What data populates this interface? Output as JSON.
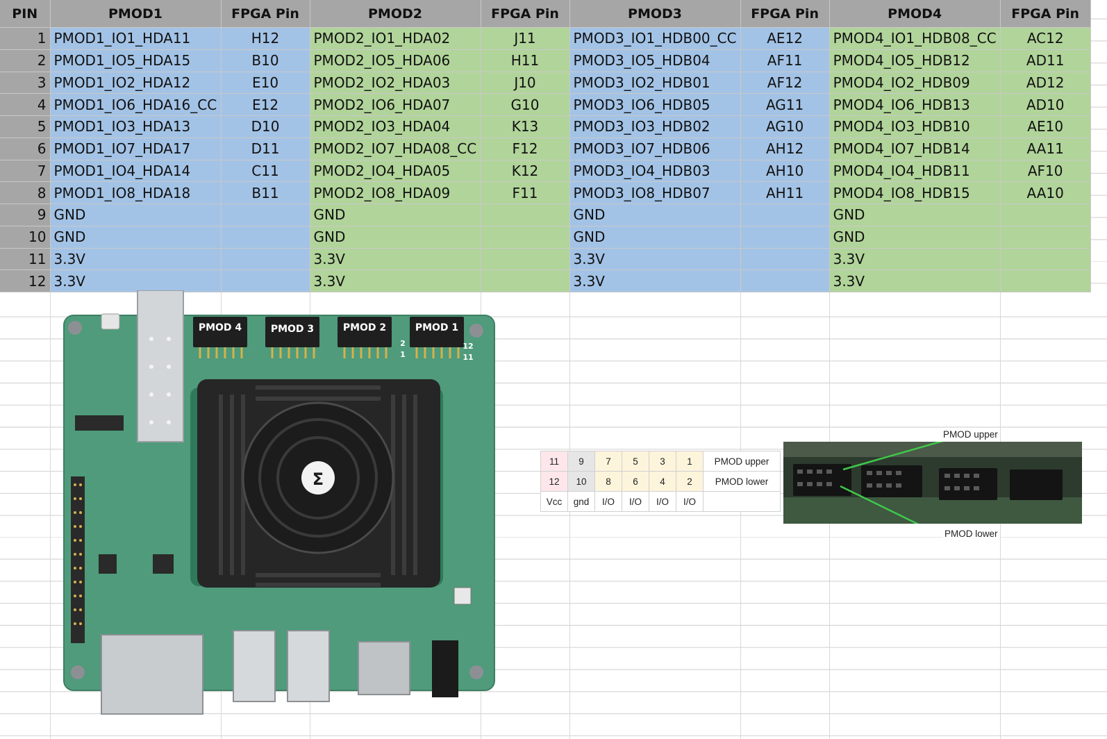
{
  "table": {
    "headers": [
      "PIN",
      "PMOD1",
      "FPGA Pin",
      "PMOD2",
      "FPGA Pin",
      "PMOD3",
      "FPGA Pin",
      "PMOD4",
      "FPGA Pin"
    ],
    "rows": [
      [
        "1",
        "PMOD1_IO1_HDA11",
        "H12",
        "PMOD2_IO1_HDA02",
        "J11",
        "PMOD3_IO1_HDB00_CC",
        "AE12",
        "PMOD4_IO1_HDB08_CC",
        "AC12"
      ],
      [
        "2",
        "PMOD1_IO5_HDA15",
        "B10",
        "PMOD2_IO5_HDA06",
        "H11",
        "PMOD3_IO5_HDB04",
        "AF11",
        "PMOD4_IO5_HDB12",
        "AD11"
      ],
      [
        "3",
        "PMOD1_IO2_HDA12",
        "E10",
        "PMOD2_IO2_HDA03",
        "J10",
        "PMOD3_IO2_HDB01",
        "AF12",
        "PMOD4_IO2_HDB09",
        "AD12"
      ],
      [
        "4",
        "PMOD1_IO6_HDA16_CC",
        "E12",
        "PMOD2_IO6_HDA07",
        "G10",
        "PMOD3_IO6_HDB05",
        "AG11",
        "PMOD4_IO6_HDB13",
        "AD10"
      ],
      [
        "5",
        "PMOD1_IO3_HDA13",
        "D10",
        "PMOD2_IO3_HDA04",
        "K13",
        "PMOD3_IO3_HDB02",
        "AG10",
        "PMOD4_IO3_HDB10",
        "AE10"
      ],
      [
        "6",
        "PMOD1_IO7_HDA17",
        "D11",
        "PMOD2_IO7_HDA08_CC",
        "F12",
        "PMOD3_IO7_HDB06",
        "AH12",
        "PMOD4_IO7_HDB14",
        "AA11"
      ],
      [
        "7",
        "PMOD1_IO4_HDA14",
        "C11",
        "PMOD2_IO4_HDA05",
        "K12",
        "PMOD3_IO4_HDB03",
        "AH10",
        "PMOD4_IO4_HDB11",
        "AF10"
      ],
      [
        "8",
        "PMOD1_IO8_HDA18",
        "B11",
        "PMOD2_IO8_HDA09",
        "F11",
        "PMOD3_IO8_HDB07",
        "AH11",
        "PMOD4_IO8_HDB15",
        "AA10"
      ],
      [
        "9",
        "GND",
        "",
        "GND",
        "",
        "GND",
        "",
        "GND",
        ""
      ],
      [
        "10",
        "GND",
        "",
        "GND",
        "",
        "GND",
        "",
        "GND",
        ""
      ],
      [
        "11",
        "3.3V",
        "",
        "3.3V",
        "",
        "3.3V",
        "",
        "3.3V",
        ""
      ],
      [
        "12",
        "3.3V",
        "",
        "3.3V",
        "",
        "3.3V",
        "",
        "3.3V",
        ""
      ]
    ]
  },
  "board": {
    "headers": [
      "PMOD 4",
      "PMOD 3",
      "PMOD 2",
      "PMOD 1"
    ],
    "pin_marks": [
      "2",
      "1",
      "12",
      "11"
    ],
    "colors": {
      "pcb": "#4f9b7b",
      "heatsink": "#2a2a2a",
      "connector": "#1f1f1f",
      "metal": "#c9ccce"
    }
  },
  "pin_diagram": {
    "upper": [
      "11",
      "9",
      "7",
      "5",
      "3",
      "1"
    ],
    "lower": [
      "12",
      "10",
      "8",
      "6",
      "4",
      "2"
    ],
    "types": [
      "Vcc",
      "gnd",
      "I/O",
      "I/O",
      "I/O",
      "I/O"
    ],
    "upper_label": "PMOD upper",
    "lower_label": "PMOD lower",
    "photo_upper_label": "PMOD upper",
    "photo_lower_label": "PMOD lower"
  },
  "colors": {
    "header_grey": "#a6a6a6",
    "blue_fill": "#a3c3e6",
    "green_fill": "#b1d49a"
  }
}
